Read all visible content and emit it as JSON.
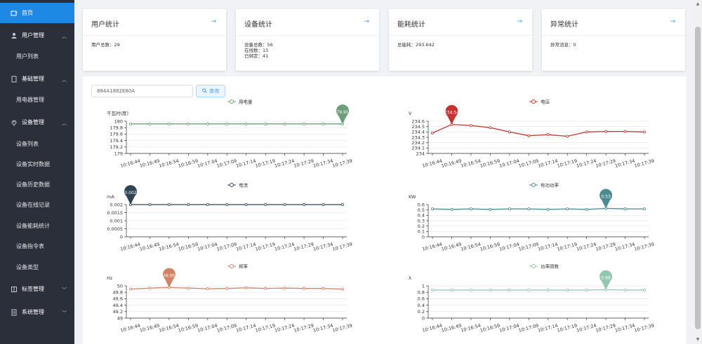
{
  "sidebar": {
    "home": "首页",
    "user_mgmt": "用户管理",
    "user_list": "用户列表",
    "base_mgmt": "基础管理",
    "appliance_mgmt": "用电器管理",
    "device_mgmt": "设备管理",
    "device_list": "设备列表",
    "device_realtime": "设备实时数据",
    "device_history": "设备历史数据",
    "device_online": "设备在线记录",
    "device_energy": "设备能耗统计",
    "device_commands": "设备指令表",
    "device_types": "设备类型",
    "tag_mgmt": "标签管理",
    "system_mgmt": "系统管理"
  },
  "cards": [
    {
      "title": "用户统计",
      "lines": [
        "用户总数：29"
      ]
    },
    {
      "title": "设备统计",
      "lines": [
        "设备总数：56",
        "在线数：15",
        "已绑定：41"
      ]
    },
    {
      "title": "能耗统计",
      "lines": [
        "总能耗：293.642"
      ]
    },
    {
      "title": "异常统计",
      "lines": [
        "异常消息：0"
      ]
    }
  ],
  "search": {
    "value": "884A1882E80A",
    "button": "查询"
  },
  "times": [
    "10:16:44",
    "10:16:49",
    "10:16:54",
    "10:16:59",
    "10:17:04",
    "10:17:09",
    "10:17:14",
    "10:17:19",
    "10:17:24",
    "10:17:29",
    "10:17:34",
    "10:17:39"
  ],
  "chart_data": [
    {
      "type": "line",
      "name": "用电量",
      "unit": "千瓦时(度)",
      "color": "#6e9e79",
      "yticks": [
        "180",
        "179.8",
        "179.6",
        "179.4",
        "179.2",
        "179"
      ],
      "ymin": 179,
      "ymax": 180,
      "values": [
        179.917,
        179.917,
        179.917,
        179.917,
        179.917,
        179.917,
        179.917,
        179.917,
        179.917,
        179.917,
        179.917,
        179.917
      ],
      "max_label": "179.917",
      "max_index": 11
    },
    {
      "type": "line",
      "name": "电压",
      "unit": "V",
      "color": "#c23531",
      "yticks": [
        "234.6",
        "234.5",
        "234.4",
        "234.3",
        "234.2",
        "234.1",
        "234"
      ],
      "ymin": 234,
      "ymax": 234.6,
      "values": [
        234.38,
        234.54,
        234.52,
        234.48,
        234.4,
        234.33,
        234.35,
        234.32,
        234.4,
        234.41,
        234.41,
        234.4,
        234.43
      ],
      "max_label": "234.54",
      "max_index": 1
    },
    {
      "type": "line",
      "name": "电流",
      "unit": "mA",
      "color": "#2f4554",
      "yticks": [
        "0.002",
        "0.0015",
        "0.001",
        "0.0005",
        "0"
      ],
      "ymin": 0,
      "ymax": 0.002,
      "values": [
        0.002,
        0.002,
        0.002,
        0.002,
        0.002,
        0.002,
        0.002,
        0.002,
        0.002,
        0.002,
        0.002,
        0.002
      ],
      "max_label": "0.002",
      "max_index": 0
    },
    {
      "type": "line",
      "name": "有功功率",
      "unit": "KW",
      "color": "#4b8b91",
      "yticks": [
        "0.6",
        "0.5",
        "0.4",
        "0.3",
        "0.2",
        "0.1",
        "0"
      ],
      "ymin": 0,
      "ymax": 0.6,
      "values": [
        0.52,
        0.51,
        0.52,
        0.51,
        0.52,
        0.52,
        0.51,
        0.52,
        0.51,
        0.53,
        0.52,
        0.52
      ],
      "max_label": "0.53",
      "max_index": 9
    },
    {
      "type": "line",
      "name": "频率",
      "unit": "Hz",
      "color": "#d48265",
      "yticks": [
        "50",
        "49.8",
        "49.6",
        "49.4",
        "49.2",
        "49"
      ],
      "ymin": 49,
      "ymax": 50,
      "values": [
        49.9,
        49.93,
        49.95,
        49.93,
        49.91,
        49.92,
        49.94,
        49.92,
        49.93,
        49.92,
        49.92,
        49.9
      ],
      "max_label": "49.95",
      "max_index": 2
    },
    {
      "type": "line",
      "name": "功率因数",
      "unit": "λ",
      "color": "#91c7ae",
      "yticks": [
        "1",
        "0.8",
        "0.6",
        "0.4",
        "0.2",
        "0"
      ],
      "ymin": 0,
      "ymax": 1,
      "values": [
        0.87,
        0.87,
        0.87,
        0.87,
        0.87,
        0.87,
        0.87,
        0.87,
        0.87,
        0.88,
        0.87,
        0.87
      ],
      "max_label": "0.88",
      "max_index": 9
    }
  ]
}
